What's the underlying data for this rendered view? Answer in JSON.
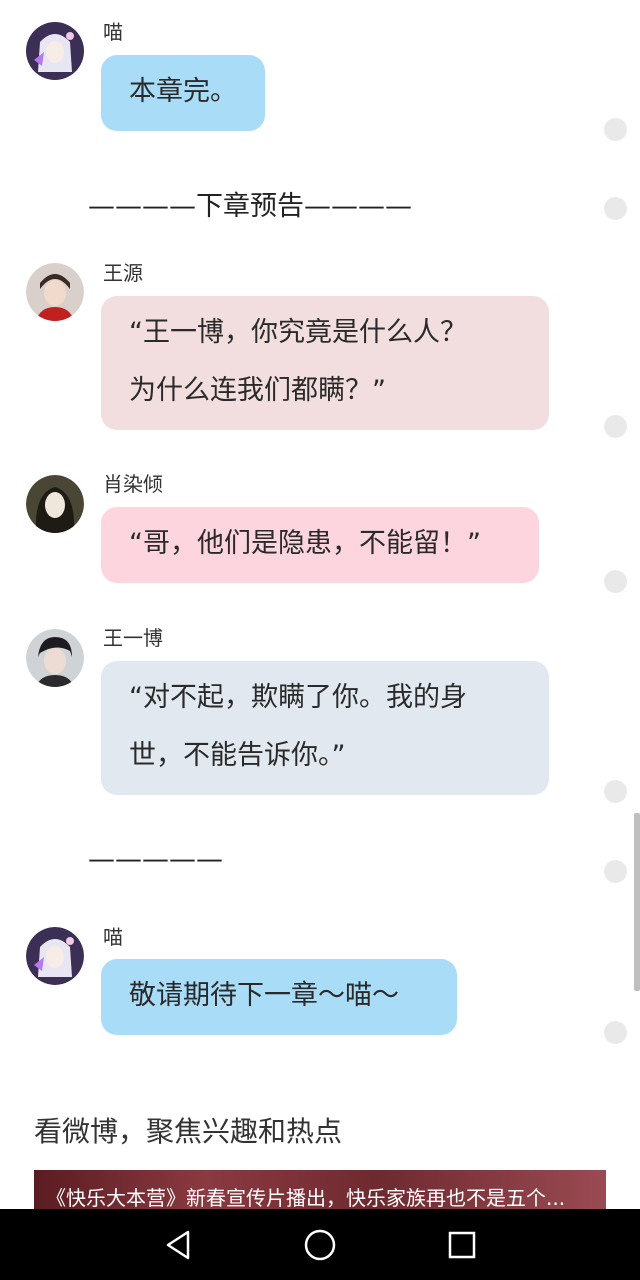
{
  "chat": {
    "messages": [
      {
        "sender": "喵",
        "text": "本章完。",
        "bubble_color": "#a9dcf7",
        "avatar": "anime-girl-avatar"
      },
      {
        "separator": "————下章预告————"
      },
      {
        "sender": "王源",
        "text_lines": [
          "“王一博，你究竟是什么人？",
          "为什么连我们都瞒？”"
        ],
        "bubble_color": "#f2dede",
        "avatar": "wangyuan-avatar"
      },
      {
        "sender": "肖染倾",
        "text": "“哥，他们是隐患，不能留！”",
        "bubble_color": "#fdd5df",
        "avatar": "xiao-ranqing-avatar"
      },
      {
        "sender": "王一博",
        "text_lines": [
          "“对不起，欺瞒了你。我的身",
          "世，不能告诉你。”"
        ],
        "bubble_color": "#e2e8f0",
        "avatar": "wang-yibo-avatar"
      },
      {
        "separator": "—————"
      },
      {
        "sender": "喵",
        "text": "敬请期待下一章～喵～",
        "bubble_color": "#a9dcf7",
        "avatar": "anime-girl-avatar"
      }
    ]
  },
  "promo": {
    "title": "看微博，聚焦兴趣和热点",
    "banner_text": "《快乐大本营》新春宣传片播出，快乐家族再也不是五个..."
  },
  "navbar": {
    "back_icon": "back-triangle-icon",
    "home_icon": "home-circle-icon",
    "recent_icon": "recent-square-icon"
  }
}
